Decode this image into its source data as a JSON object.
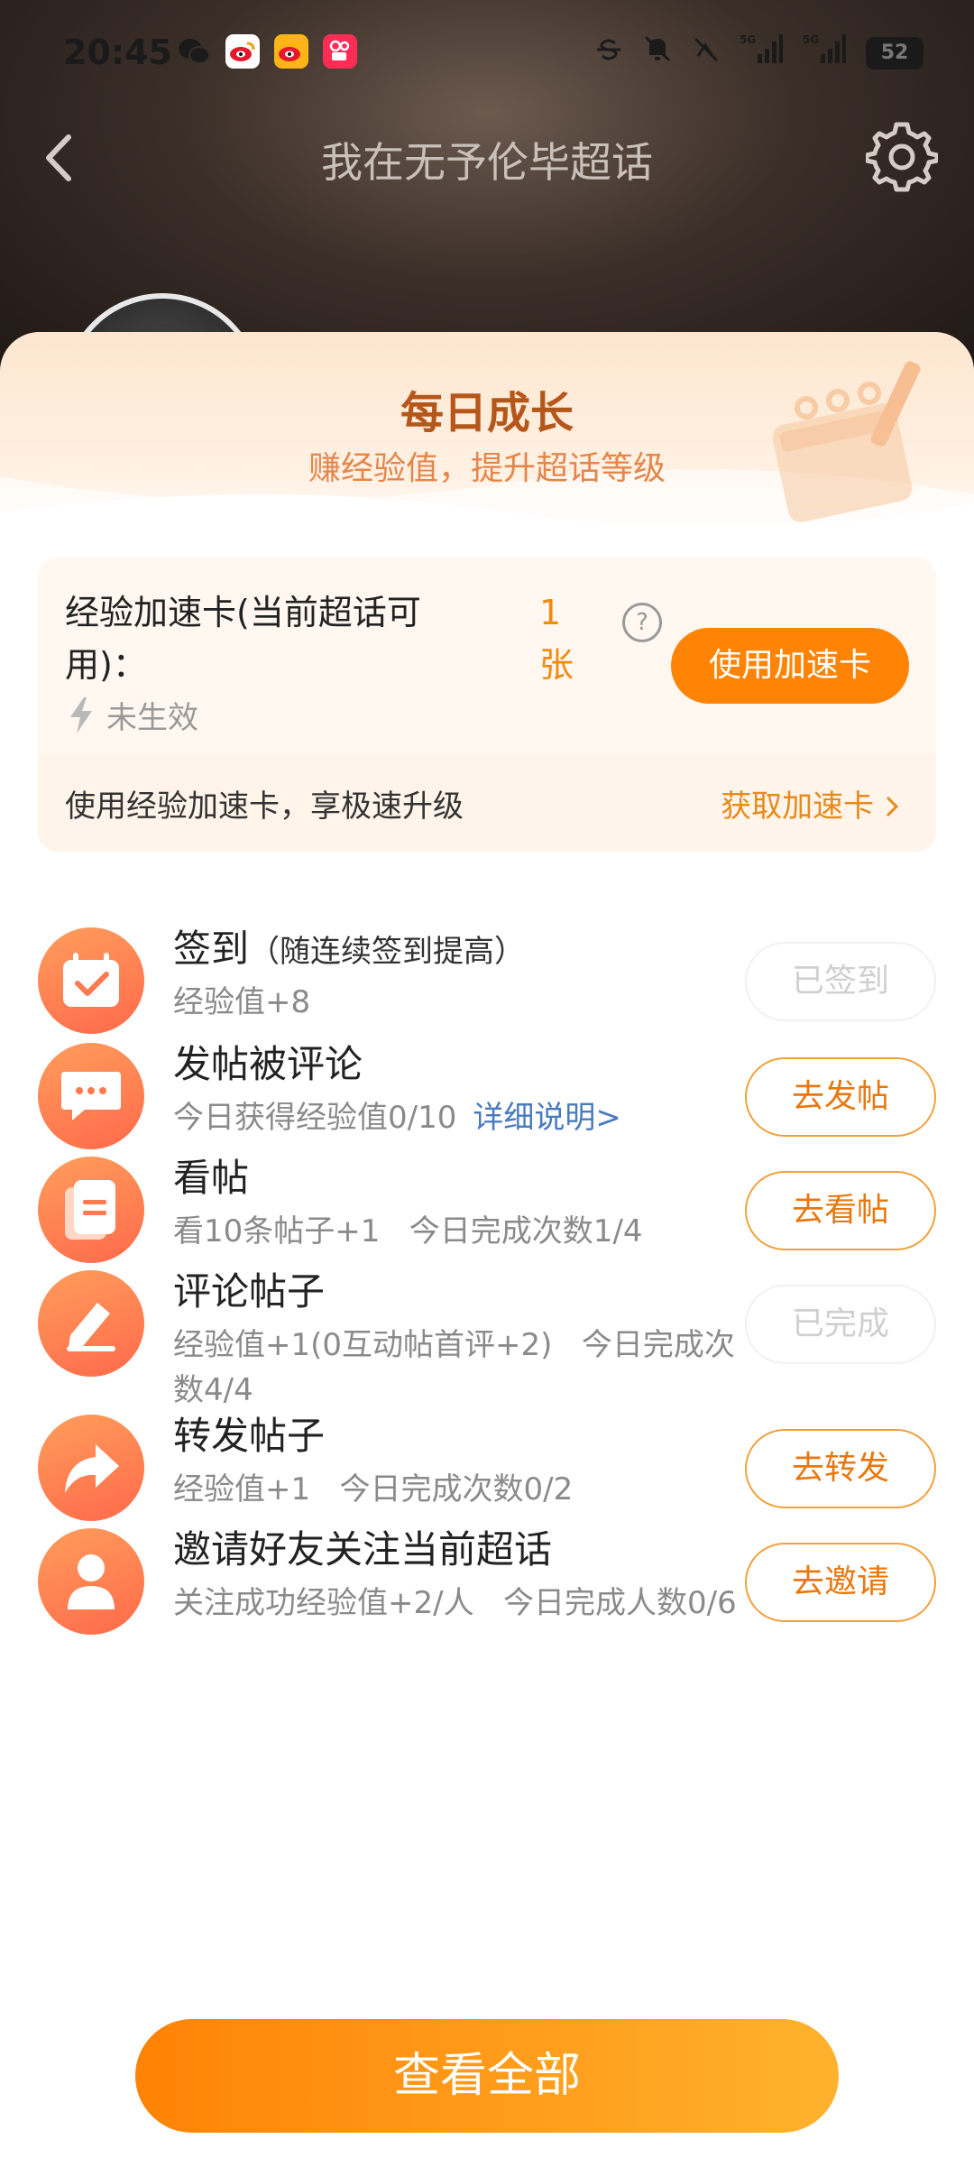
{
  "status_bar": {
    "time": "20:45",
    "apps": [
      "wechat-icon",
      "weibo-icon",
      "weibo-alt-icon",
      "kuaishou-icon"
    ],
    "indicators": [
      "strike-icon",
      "mute-icon",
      "nfc-icon",
      "5G",
      "5G"
    ],
    "battery": "52"
  },
  "nav": {
    "title": "我在无予伦毕超话"
  },
  "sheet": {
    "title": "每日成长",
    "subtitle": "赚经验值，提升超话等级"
  },
  "accel_card": {
    "label": "经验加速卡(当前超话可用)：",
    "count": "1 张",
    "help": "?",
    "use_button": "使用加速卡",
    "status": "未生效",
    "footer_text": "使用经验加速卡，享极速升级",
    "footer_link": "获取加速卡"
  },
  "tasks": [
    {
      "title": "签到",
      "hint": "（随连续签到提高）",
      "desc": "经验值+8",
      "link": "",
      "button": "已签到",
      "done": true,
      "icon": "calendar-check-icon"
    },
    {
      "title": "发帖被评论",
      "hint": "",
      "desc": "今日获得经验值0/10",
      "link": "详细说明>",
      "button": "去发帖",
      "done": false,
      "icon": "chat-bubble-icon"
    },
    {
      "title": "看帖",
      "hint": "",
      "desc": "看10条帖子+1   今日完成次数1/4",
      "link": "",
      "button": "去看帖",
      "done": false,
      "icon": "document-icon"
    },
    {
      "title": "评论帖子",
      "hint": "",
      "desc": "经验值+1(0互动帖首评+2)   今日完成次数4/4",
      "link": "",
      "button": "已完成",
      "done": true,
      "icon": "edit-icon"
    },
    {
      "title": "转发帖子",
      "hint": "",
      "desc": "经验值+1   今日完成次数0/2",
      "link": "",
      "button": "去转发",
      "done": false,
      "icon": "share-arrow-icon"
    },
    {
      "title": "邀请好友关注当前超话",
      "hint": "",
      "desc": "关注成功经验值+2/人   今日完成人数0/6",
      "link": "",
      "button": "去邀请",
      "done": false,
      "icon": "person-icon"
    }
  ],
  "view_all": "查看全部",
  "colors": {
    "accent": "#ff8405",
    "title_brown": "#b5561a",
    "link_blue": "#4a7bbd"
  }
}
